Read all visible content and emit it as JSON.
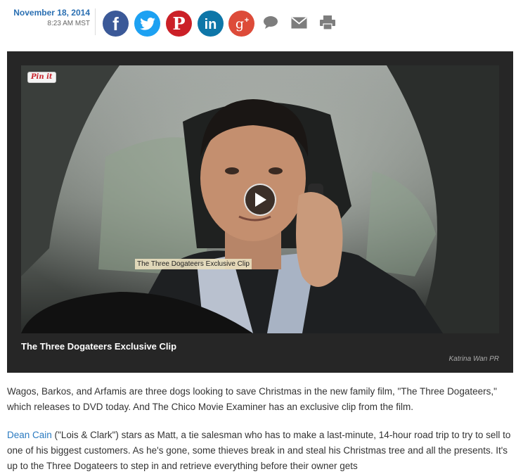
{
  "header": {
    "date": "November 18, 2014",
    "time": "8:23 AM MST",
    "share": [
      {
        "name": "facebook-share",
        "icon": "facebook-icon",
        "glyph": "f",
        "color": "#3b5998"
      },
      {
        "name": "twitter-share",
        "icon": "twitter-icon",
        "glyph": "bird",
        "color": "#1da1f2"
      },
      {
        "name": "pinterest-share",
        "icon": "pinterest-icon",
        "glyph": "P",
        "color": "#cb2027"
      },
      {
        "name": "linkedin-share",
        "icon": "linkedin-icon",
        "glyph": "in",
        "color": "#0e76a8"
      },
      {
        "name": "googleplus-share",
        "icon": "google-plus-icon",
        "glyph": "g+",
        "color": "#dd4b39"
      }
    ],
    "actions": [
      {
        "name": "comment-button",
        "icon": "comment-icon"
      },
      {
        "name": "email-button",
        "icon": "mail-icon"
      },
      {
        "name": "print-button",
        "icon": "print-icon"
      }
    ]
  },
  "media": {
    "pin_label": "Pin it",
    "tooltip": "The Three Dogateers Exclusive Clip",
    "caption": "The Three Dogateers Exclusive Clip",
    "credit": "Katrina Wan PR"
  },
  "article": {
    "p1": "Wagos, Barkos, and Arfamis are three dogs looking to save Christmas in the new family film, \"The Three Dogateers,\" which releases to DVD today. And The Chico Movie Examiner has an exclusive clip from the film.",
    "p2_link": "Dean Cain",
    "p2_rest": " (\"Lois & Clark\") stars as Matt, a tie salesman who has to make a last-minute, 14-hour road trip to try to sell to one of his biggest customers. As he's gone, some thieves break in and steal his Christmas tree and all the presents. It's up to the Three Dogateers to step in and retrieve everything before their owner gets"
  }
}
